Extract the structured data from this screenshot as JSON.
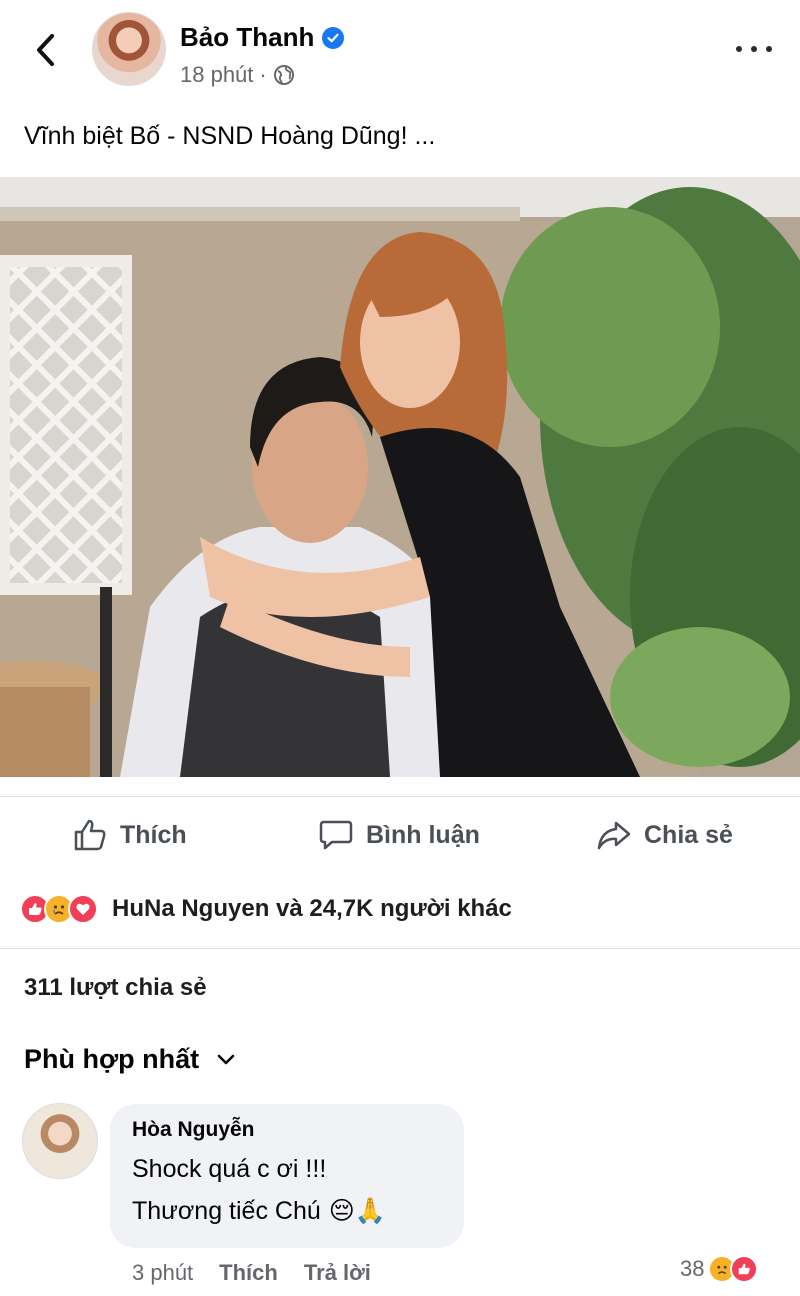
{
  "post": {
    "author_name": "Bảo Thanh",
    "time": "18 phút",
    "separator": "·",
    "text": "Vĩnh biệt Bố - NSND Hoàng Dũng! ...",
    "verified": true
  },
  "actions": {
    "like": "Thích",
    "comment": "Bình luận",
    "share": "Chia sẻ"
  },
  "reactions": {
    "icons": [
      "like-icon",
      "sad-icon",
      "love-icon"
    ],
    "text": "HuNa Nguyen và 24,7K người khác"
  },
  "shares_text": "311 lượt chia sẻ",
  "sort_label": "Phù hợp nhất",
  "comment": {
    "author": "Hòa Nguyễn",
    "line1": "Shock quá c ơi !!!",
    "line2": "Thương tiếc Chú",
    "emoji": "😔🙏",
    "time": "3 phút",
    "like_label": "Thích",
    "reply_label": "Trả lời",
    "reaction_count": "38",
    "reaction_icons": [
      "sad-icon",
      "like-icon"
    ]
  },
  "colors": {
    "accent": "#1877f2",
    "like_red": "#f33e58",
    "sad_yellow": "#f7b125",
    "text_secondary": "#65676b"
  }
}
